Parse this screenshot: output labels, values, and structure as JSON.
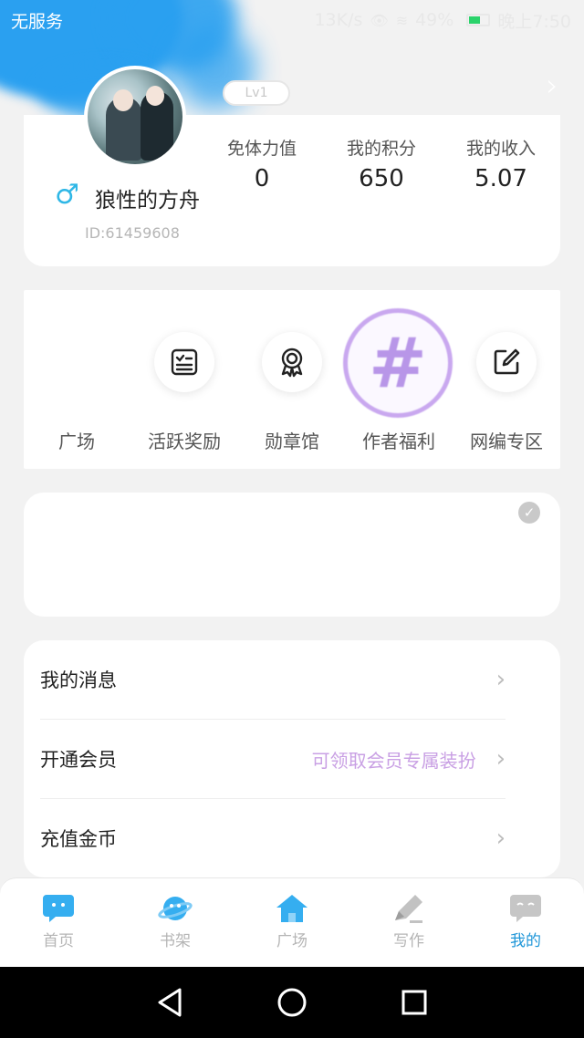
{
  "status_bar": {
    "carrier": "无服务",
    "speed": "13K/s",
    "battery_percent": "49%",
    "time": "晚上7:50"
  },
  "profile": {
    "level": "Lv1",
    "nickname": "狼性的方舟",
    "user_id": "ID:61459608",
    "gender_symbol": "♂",
    "stats": [
      {
        "label": "免体力值",
        "value": "0"
      },
      {
        "label": "我的积分",
        "value": "650"
      },
      {
        "label": "我的收入",
        "value": "5.07"
      }
    ]
  },
  "quick_menu": [
    {
      "label": "广场",
      "icon": "none"
    },
    {
      "label": "活跃奖励",
      "icon": "checklist-icon"
    },
    {
      "label": "勋章馆",
      "icon": "medal-icon"
    },
    {
      "label": "作者福利",
      "icon": "hashtag-icon"
    },
    {
      "label": "网编专区",
      "icon": "edit-box-icon"
    }
  ],
  "list": [
    {
      "title": "我的消息",
      "extra": ""
    },
    {
      "title": "开通会员",
      "extra": "可领取会员专属装扮"
    },
    {
      "title": "充值金币",
      "extra": ""
    }
  ],
  "bottom_nav": [
    {
      "label": "首页",
      "icon": "chat-bubble-icon",
      "active": false
    },
    {
      "label": "书架",
      "icon": "planet-icon",
      "active": false
    },
    {
      "label": "广场",
      "icon": "home-icon",
      "active": false
    },
    {
      "label": "写作",
      "icon": "pen-icon",
      "active": false
    },
    {
      "label": "我的",
      "icon": "chat-face-icon",
      "active": true
    }
  ],
  "colors": {
    "accent_blue": "#1f96d8",
    "brush_blue": "#2aa0f0",
    "vip_purple": "#c9a0e4",
    "background": "#f2f2f2"
  }
}
